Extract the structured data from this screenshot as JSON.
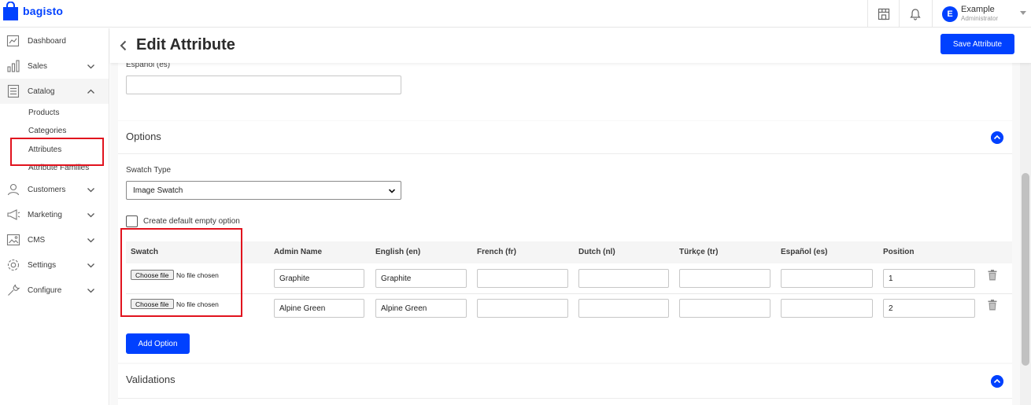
{
  "app": {
    "logo_text": "bagisto",
    "brand_color": "#0041ff",
    "highlight_color": "#e1131e"
  },
  "topbar": {
    "icons": [
      "store-icon",
      "bell-icon"
    ],
    "user": {
      "initial": "E",
      "name": "Example",
      "role": "Administrator"
    }
  },
  "sidebar": {
    "items": [
      {
        "label": "Dashboard",
        "icon": "dashboard-icon"
      },
      {
        "label": "Sales",
        "icon": "sales-icon"
      },
      {
        "label": "Catalog",
        "icon": "catalog-icon"
      },
      {
        "label": "Customers",
        "icon": "customers-icon"
      },
      {
        "label": "Marketing",
        "icon": "marketing-icon"
      },
      {
        "label": "CMS",
        "icon": "cms-icon"
      },
      {
        "label": "Settings",
        "icon": "settings-icon"
      },
      {
        "label": "Configure",
        "icon": "configure-icon"
      }
    ],
    "catalog_sub": [
      "Products",
      "Categories",
      "Attributes",
      "Attribute Families"
    ]
  },
  "header": {
    "title": "Edit Attribute",
    "save_label": "Save Attribute"
  },
  "labels_section": {
    "field_label": "Español (es)",
    "value": ""
  },
  "options": {
    "title": "Options",
    "swatch_type_label": "Swatch Type",
    "swatch_type_value": "Image Swatch",
    "default_option_label": "Create default empty option",
    "default_option_checked": false,
    "columns": [
      "Swatch",
      "Admin Name",
      "English (en)",
      "French (fr)",
      "Dutch (nl)",
      "Türkçe (tr)",
      "Español (es)",
      "Position"
    ],
    "file_button_label": "Choose file",
    "file_status": "No file chosen",
    "rows": [
      {
        "admin_name": "Graphite",
        "en": "Graphite",
        "fr": "",
        "nl": "",
        "tr": "",
        "es": "",
        "position": "1"
      },
      {
        "admin_name": "Alpine Green",
        "en": "Alpine Green",
        "fr": "",
        "nl": "",
        "tr": "",
        "es": "",
        "position": "2"
      }
    ],
    "add_option_label": "Add Option"
  },
  "validations": {
    "title": "Validations"
  }
}
